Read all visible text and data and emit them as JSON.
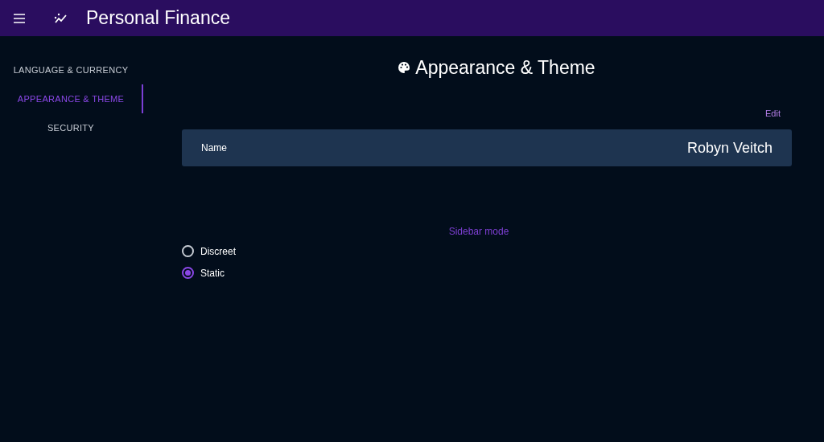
{
  "app_bar": {
    "title": "Personal Finance"
  },
  "sidebar": {
    "items": [
      {
        "label": "LANGUAGE & CURRENCY",
        "selected": false
      },
      {
        "label": "APPEARANCE & THEME",
        "selected": true
      },
      {
        "label": "SECURITY",
        "selected": false
      }
    ]
  },
  "page": {
    "title": "Appearance & Theme",
    "edit_link": "Edit",
    "name_row": {
      "label": "Name",
      "value": "Robyn Veitch"
    },
    "sidebar_mode": {
      "label": "Sidebar mode",
      "options": [
        {
          "label": "Discreet",
          "selected": false
        },
        {
          "label": "Static",
          "selected": true
        }
      ]
    }
  }
}
